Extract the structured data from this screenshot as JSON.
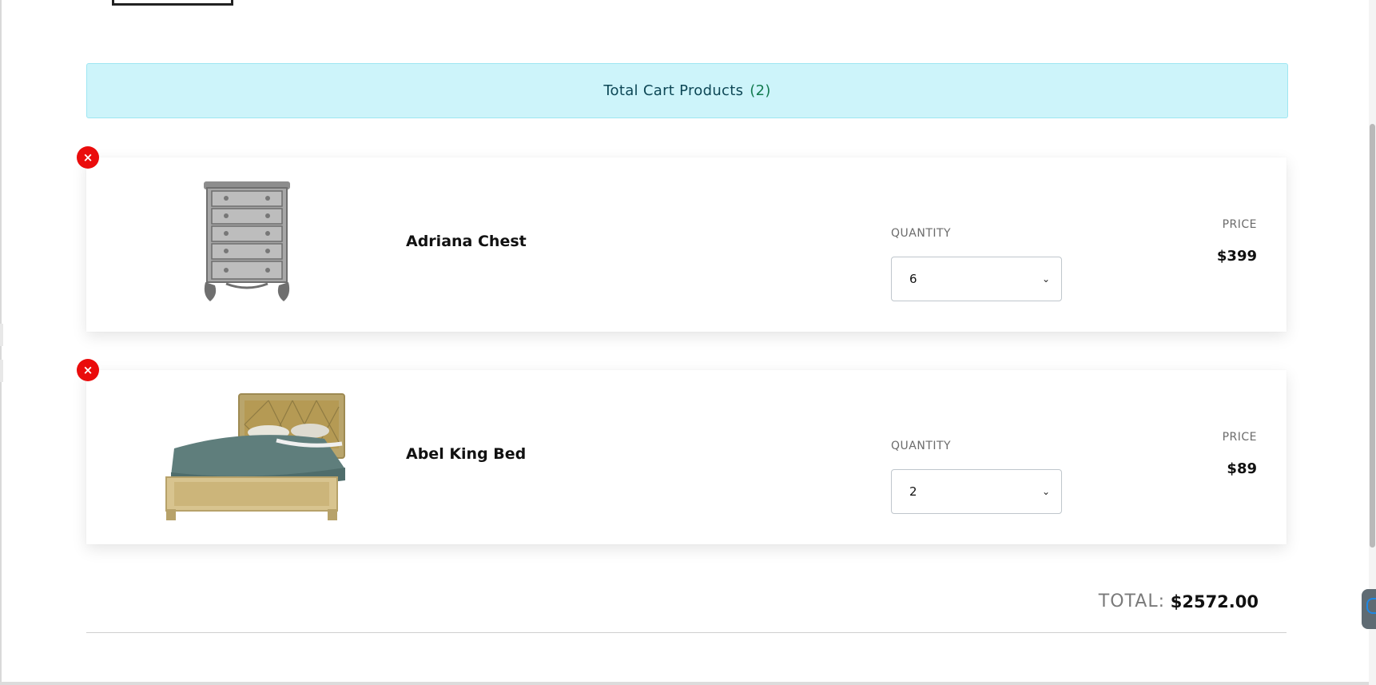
{
  "banner": {
    "label": "Total Cart Products",
    "count": "(2)"
  },
  "cart": {
    "items": [
      {
        "name": "Adriana Chest",
        "quantity_label": "QUANTITY",
        "quantity": "6",
        "price_label": "PRICE",
        "price": "$399",
        "remove_icon": "×",
        "image_icon": "chest-of-drawers"
      },
      {
        "name": "Abel King Bed",
        "quantity_label": "QUANTITY",
        "quantity": "2",
        "price_label": "PRICE",
        "price": "$89",
        "remove_icon": "×",
        "image_icon": "king-bed"
      }
    ]
  },
  "summary": {
    "total_label": "TOTAL:",
    "total_value": "$2572.00"
  },
  "colors": {
    "banner_bg": "#cdf4fa",
    "remove_red": "#ea0c0c",
    "count_green": "#127a4f"
  }
}
